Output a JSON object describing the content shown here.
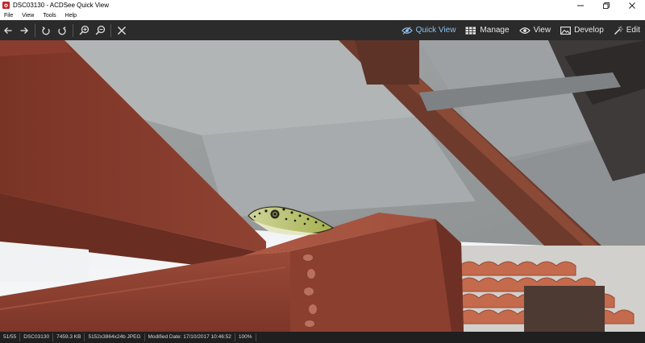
{
  "window": {
    "title": "DSC03130 - ACDSee Quick View",
    "minimize_icon": "minimize-icon",
    "maximize_icon": "restore-icon",
    "close_icon": "close-icon"
  },
  "menu": {
    "items": [
      "File",
      "View",
      "Tools",
      "Help"
    ]
  },
  "toolbar": {
    "buttons": [
      "back-arrow-icon",
      "forward-arrow-icon",
      "rotate-left-icon",
      "rotate-right-icon",
      "zoom-in-icon",
      "zoom-out-icon",
      "close-x-icon"
    ],
    "modes": [
      {
        "label": "Quick View",
        "icon": "eye-icon",
        "active": true
      },
      {
        "label": "Manage",
        "icon": "grid-icon",
        "active": false
      },
      {
        "label": "View",
        "icon": "eye-icon",
        "active": false
      },
      {
        "label": "Develop",
        "icon": "image-icon",
        "active": false
      },
      {
        "label": "Edit",
        "icon": "wand-icon",
        "active": false
      }
    ]
  },
  "status": {
    "position": "51/55",
    "filename": "DSC03130",
    "size": "7459.3 KB",
    "dimensions": "5152x3864x24b JPEG",
    "modified": "Modified Date: 17/10/2017 10:46:52",
    "zoom": "100%"
  },
  "colors": {
    "toolbar_bg": "#2b2b2b",
    "active_mode": "#8fc1ee",
    "statusbar_bg": "#1f1f1f"
  }
}
